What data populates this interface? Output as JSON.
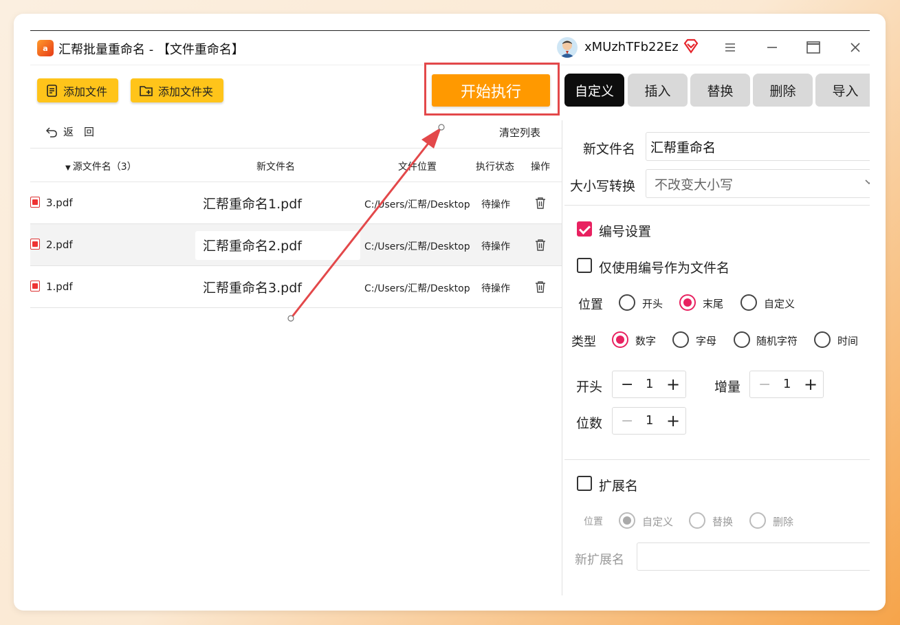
{
  "app": {
    "title": "汇帮批量重命名 - 【文件重命名】",
    "username": "xMUzhTFb22Ez",
    "logo_text": "a"
  },
  "window": {
    "menu_icon": "hamburger-icon",
    "minimize_icon": "minimize-icon",
    "maximize_icon": "maximize-icon",
    "close_icon": "close-icon"
  },
  "toolbar": {
    "add_file": "添加文件",
    "add_folder": "添加文件夹",
    "start": "开始执行",
    "back": "返　回",
    "clear_list": "清空列表"
  },
  "table": {
    "headers": {
      "source": "源文件名（3）",
      "new_name": "新文件名",
      "location": "文件位置",
      "status": "执行状态",
      "action": "操作"
    },
    "rows": [
      {
        "source": "3.pdf",
        "new_name": "汇帮重命名1.pdf",
        "location": "C:/Users/汇帮/Desktop",
        "status": "待操作"
      },
      {
        "source": "2.pdf",
        "new_name": "汇帮重命名2.pdf",
        "location": "C:/Users/汇帮/Desktop",
        "status": "待操作"
      },
      {
        "source": "1.pdf",
        "new_name": "汇帮重命名3.pdf",
        "location": "C:/Users/汇帮/Desktop",
        "status": "待操作"
      }
    ]
  },
  "tabs": [
    "自定义",
    "插入",
    "替换",
    "删除",
    "导入"
  ],
  "panel": {
    "new_name_label": "新文件名",
    "new_name_value": "汇帮重命名",
    "case_label": "大小写转换",
    "case_value": "不改变大小写",
    "numbering_label": "编号设置",
    "numbering_checked": true,
    "only_number_label": "仅使用编号作为文件名",
    "only_number_checked": false,
    "position_label": "位置",
    "position_options": [
      "开头",
      "末尾",
      "自定义"
    ],
    "position_selected": "末尾",
    "type_label": "类型",
    "type_options": [
      "数字",
      "字母",
      "随机字符",
      "时间"
    ],
    "type_selected": "数字",
    "start_label": "开头",
    "start_value": "1",
    "increment_label": "增量",
    "increment_value": "1",
    "digits_label": "位数",
    "digits_value": "1",
    "ext_label": "扩展名",
    "ext_checked": false,
    "ext_position_label": "位置",
    "ext_options": [
      "自定义",
      "替换",
      "删除"
    ],
    "ext_selected": "自定义",
    "new_ext_label": "新扩展名",
    "new_ext_value": ""
  },
  "colors": {
    "accent": "#e82160",
    "toolbar_button": "#ffc41a",
    "start_button": "#ff9900",
    "highlight": "#e3484a"
  }
}
